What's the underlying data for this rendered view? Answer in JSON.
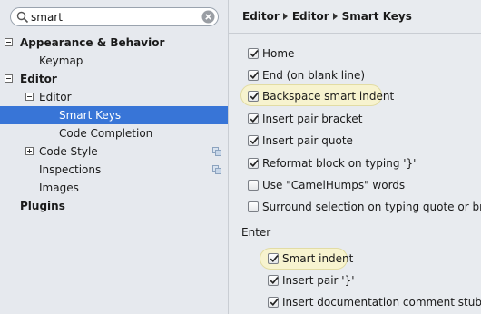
{
  "search": {
    "value": "smart"
  },
  "tree": {
    "appearance": "Appearance & Behavior",
    "keymap": "Keymap",
    "editor": "Editor",
    "editor_sub": "Editor",
    "smart_keys": "Smart Keys",
    "code_completion": "Code Completion",
    "code_style": "Code Style",
    "inspections": "Inspections",
    "images": "Images",
    "plugins": "Plugins"
  },
  "breadcrumb": {
    "part1": "Editor",
    "part2": "Editor",
    "part3": "Smart Keys"
  },
  "options": {
    "home": "Home",
    "end": "End (on blank line)",
    "backspace": "Backspace smart indent",
    "pair_bracket": "Insert pair bracket",
    "pair_quote": "Insert pair quote",
    "reformat": "Reformat block on typing '}'",
    "camelhumps": "Use \"CamelHumps\" words",
    "surround": "Surround selection on typing quote or brace"
  },
  "enter": {
    "section": "Enter",
    "smart_indent": "Smart indent",
    "pair_brace": "Insert pair '}'",
    "doc_stub": "Insert documentation comment stub"
  },
  "checked": {
    "home": true,
    "end": true,
    "backspace": true,
    "pair_bracket": true,
    "pair_quote": true,
    "reformat": true,
    "camelhumps": false,
    "surround": false,
    "smart_indent": true,
    "pair_brace": true,
    "doc_stub": true
  },
  "colors": {
    "selection": "#3875d7",
    "highlight": "#f7f3cf"
  }
}
